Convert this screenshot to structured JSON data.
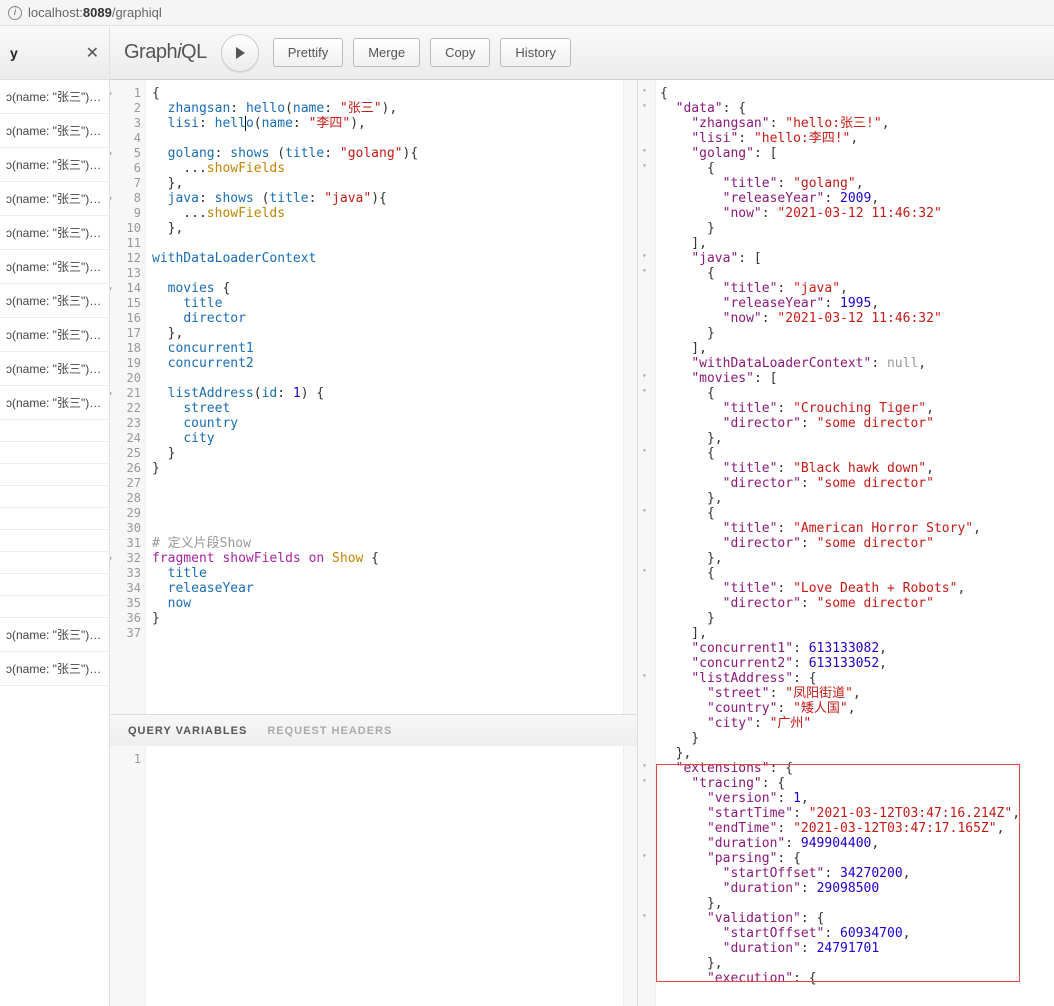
{
  "address_bar": {
    "url_pre": "localhost:",
    "url_bold": "8089",
    "url_post": "/graphiql"
  },
  "sidebar": {
    "title": "y",
    "item_text": "ɔ(name: \"张三\")…"
  },
  "toolbar": {
    "brand_pre": "Graph",
    "brand_i": "i",
    "brand_post": "QL",
    "prettify": "Prettify",
    "merge": "Merge",
    "copy": "Copy",
    "history": "History"
  },
  "variables_tabs": {
    "qv": "QUERY VARIABLES",
    "rh": "REQUEST HEADERS"
  },
  "query_lines": [
    "{",
    "  <span class='t-key'>zhangsan</span>: <span class='t-attr'>hello</span>(<span class='t-attr'>name</span>: <span class='t-str'>\"张三\"</span>),",
    "  <span class='t-key'>lisi</span>: <span class='t-attr'>hell</span><span class='cursor'></span><span class='t-attr'>o</span>(<span class='t-attr'>name</span>: <span class='t-str'>\"李四\"</span>),",
    "",
    "  <span class='t-key'>golang</span>: <span class='t-attr'>shows</span> (<span class='t-attr'>title</span>: <span class='t-str'>\"golang\"</span>){",
    "    ...<span class='t-frag'>showFields</span>",
    "  },",
    "  <span class='t-key'>java</span>: <span class='t-attr'>shows</span> (<span class='t-attr'>title</span>: <span class='t-str'>\"java\"</span>){",
    "    ...<span class='t-frag'>showFields</span>",
    "  },",
    "",
    "<span class='t-attr'>withDataLoaderContext</span>",
    "",
    "  <span class='t-attr'>movies</span> {",
    "    <span class='t-attr'>title</span>",
    "    <span class='t-attr'>director</span>",
    "  },",
    "  <span class='t-attr'>concurrent1</span>",
    "  <span class='t-attr'>concurrent2</span>",
    "",
    "  <span class='t-attr'>listAddress</span>(<span class='t-attr'>id</span>: <span class='t-num'>1</span>) {",
    "    <span class='t-attr'>street</span>",
    "    <span class='t-attr'>country</span>",
    "    <span class='t-attr'>city</span>",
    "  }",
    "}",
    "",
    "",
    "",
    "",
    "<span class='t-comment'># 定义片段Show</span>",
    "<span class='t-kw'>fragment</span> <span class='t-def'>showFields</span> <span class='t-kw'>on</span> <span class='t-type'>Show</span> {",
    "  <span class='t-attr'>title</span>",
    "  <span class='t-attr'>releaseYear</span>",
    "  <span class='t-attr'>now</span>",
    "}",
    ""
  ],
  "result_lines": [
    "{",
    "  <span class='jk'>\"data\"</span>: {",
    "    <span class='jk'>\"zhangsan\"</span>: <span class='js'>\"hello:张三!\"</span>,",
    "    <span class='jk'>\"lisi\"</span>: <span class='js'>\"hello:李四!\"</span>,",
    "    <span class='jk'>\"golang\"</span>: [",
    "      {",
    "        <span class='jk'>\"title\"</span>: <span class='js'>\"golang\"</span>,",
    "        <span class='jk'>\"releaseYear\"</span>: <span class='jn'>2009</span>,",
    "        <span class='jk'>\"now\"</span>: <span class='js'>\"2021-03-12 11:46:32\"</span>",
    "      }",
    "    ],",
    "    <span class='jk'>\"java\"</span>: [",
    "      {",
    "        <span class='jk'>\"title\"</span>: <span class='js'>\"java\"</span>,",
    "        <span class='jk'>\"releaseYear\"</span>: <span class='jn'>1995</span>,",
    "        <span class='jk'>\"now\"</span>: <span class='js'>\"2021-03-12 11:46:32\"</span>",
    "      }",
    "    ],",
    "    <span class='jk'>\"withDataLoaderContext\"</span>: <span class='jb'>null</span>,",
    "    <span class='jk'>\"movies\"</span>: [",
    "      {",
    "        <span class='jk'>\"title\"</span>: <span class='js'>\"Crouching Tiger\"</span>,",
    "        <span class='jk'>\"director\"</span>: <span class='js'>\"some director\"</span>",
    "      },",
    "      {",
    "        <span class='jk'>\"title\"</span>: <span class='js'>\"Black hawk down\"</span>,",
    "        <span class='jk'>\"director\"</span>: <span class='js'>\"some director\"</span>",
    "      },",
    "      {",
    "        <span class='jk'>\"title\"</span>: <span class='js'>\"American Horror Story\"</span>,",
    "        <span class='jk'>\"director\"</span>: <span class='js'>\"some director\"</span>",
    "      },",
    "      {",
    "        <span class='jk'>\"title\"</span>: <span class='js'>\"Love Death + Robots\"</span>,",
    "        <span class='jk'>\"director\"</span>: <span class='js'>\"some director\"</span>",
    "      }",
    "    ],",
    "    <span class='jk'>\"concurrent1\"</span>: <span class='jn'>613133082</span>,",
    "    <span class='jk'>\"concurrent2\"</span>: <span class='jn'>613133052</span>,",
    "    <span class='jk'>\"listAddress\"</span>: {",
    "      <span class='jk'>\"street\"</span>: <span class='js'>\"凤阳街道\"</span>,",
    "      <span class='jk'>\"country\"</span>: <span class='js'>\"矮人国\"</span>,",
    "      <span class='jk'>\"city\"</span>: <span class='js'>\"广州\"</span>",
    "    }",
    "  },",
    "  <span class='jk'>\"extensions\"</span>: {",
    "    <span class='jk'>\"tracing\"</span>: {",
    "      <span class='jk'>\"version\"</span>: <span class='jn'>1</span>,",
    "      <span class='jk'>\"startTime\"</span>: <span class='js'>\"2021-03-12T03:47:16.214Z\"</span>,",
    "      <span class='jk'>\"endTime\"</span>: <span class='js'>\"2021-03-12T03:47:17.165Z\"</span>,",
    "      <span class='jk'>\"duration\"</span>: <span class='jn'>949904400</span>,",
    "      <span class='jk'>\"parsing\"</span>: {",
    "        <span class='jk'>\"startOffset\"</span>: <span class='jn'>34270200</span>,",
    "        <span class='jk'>\"duration\"</span>: <span class='jn'>29098500</span>",
    "      },",
    "      <span class='jk'>\"validation\"</span>: {",
    "        <span class='jk'>\"startOffset\"</span>: <span class='jn'>60934700</span>,",
    "        <span class='jk'>\"duration\"</span>: <span class='jn'>24791701</span>",
    "      },",
    "      <span class='jk'>\"execution\"</span>: {"
  ],
  "fold_lines_query": [
    1,
    5,
    8,
    14,
    21,
    32
  ],
  "fold_lines_result": [
    0,
    1,
    4,
    5,
    11,
    12,
    19,
    20,
    24,
    28,
    32,
    39,
    45,
    46,
    51,
    55
  ]
}
